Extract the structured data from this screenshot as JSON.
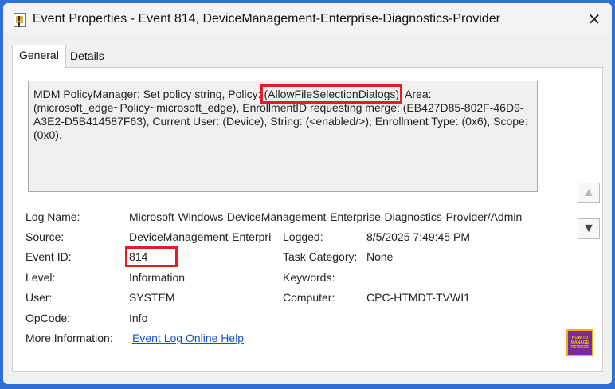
{
  "window": {
    "title": "Event Properties - Event 814, DeviceManagement-Enterprise-Diagnostics-Provider",
    "close_glyph": "✕"
  },
  "tabs": [
    {
      "label": "General",
      "selected": true
    },
    {
      "label": "Details",
      "selected": false
    }
  ],
  "description": {
    "before": "MDM PolicyManager: Set policy string, Policy: ",
    "highlight": "(AllowFileSelectionDialogs)",
    "after": ", Area: (microsoft_edge~Policy~microsoft_edge), EnrollmentID requesting merge: (EB427D85-802F-46D9-A3E2-D5B414587F63), Current User: (Device), String: (<enabled/>), Enrollment Type: (0x6), Scope: (0x0)."
  },
  "fields": {
    "log_name_label": "Log Name:",
    "log_name_value": "Microsoft-Windows-DeviceManagement-Enterprise-Diagnostics-Provider/Admin",
    "source_label": "Source:",
    "source_value": "DeviceManagement-Enterpri",
    "logged_label": "Logged:",
    "logged_value": "8/5/2025 7:49:45 PM",
    "event_id_label": "Event ID:",
    "event_id_value": "814",
    "task_category_label": "Task Category:",
    "task_category_value": "None",
    "level_label": "Level:",
    "level_value": "Information",
    "keywords_label": "Keywords:",
    "keywords_value": "",
    "user_label": "User:",
    "user_value": "SYSTEM",
    "computer_label": "Computer:",
    "computer_value": "CPC-HTMDT-TVWI1",
    "opcode_label": "OpCode:",
    "opcode_value": "Info",
    "more_info_label": "More Information:",
    "more_info_link": "Event Log Online Help"
  },
  "icons": {
    "up": "▲",
    "down": "▼",
    "app": "event-viewer-icon"
  },
  "logo": {
    "line1": "HOW TO",
    "line2": "MANAGE",
    "line3": "DEVICES"
  },
  "colors": {
    "highlight_border": "#e11d25",
    "link": "#1a53c7",
    "frame": "#2f6fd6"
  }
}
